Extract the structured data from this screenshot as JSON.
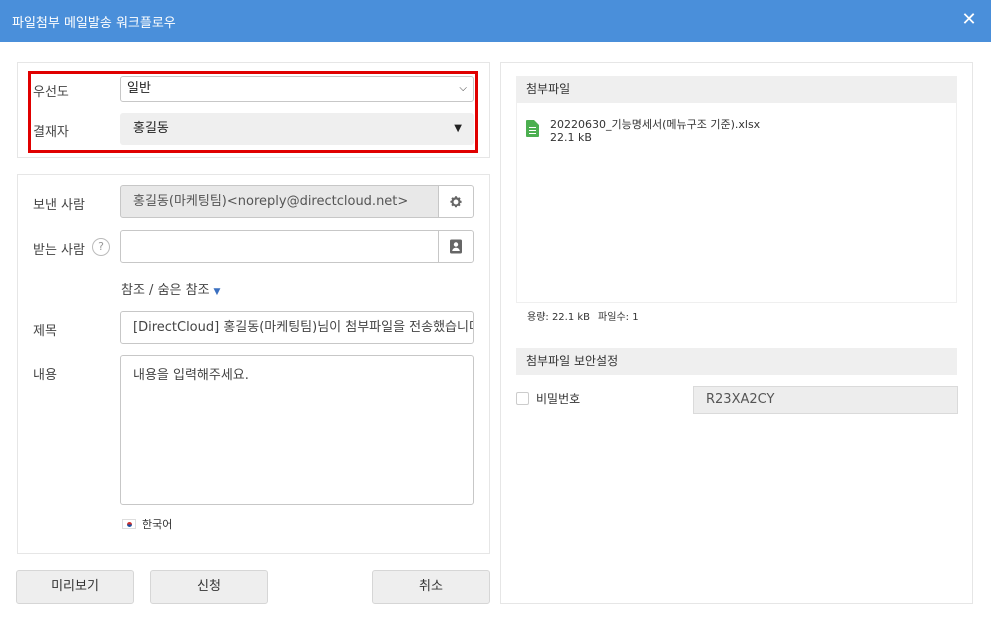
{
  "dialog": {
    "title": "파일첨부 메일발송 워크플로우",
    "close_label": "✕"
  },
  "approval": {
    "priority_label": "우선도",
    "priority_value": "일반",
    "approver_label": "결재자",
    "approver_value": "홍길동"
  },
  "mail": {
    "sender_label": "보낸 사람",
    "sender_value": "홍길동(마케팅팀)<noreply@directcloud.net>",
    "recipient_label": "받는 사람",
    "recipient_value": "",
    "help_label": "?",
    "cc_label": "참조 / 숨은 참조",
    "subject_label": "제목",
    "subject_value": "[DirectCloud] 홍길동(마케팅팀)님이 첨부파일을 전송했습니다",
    "body_label": "내용",
    "body_placeholder": "내용을 입력해주세요.",
    "language": "한국어"
  },
  "buttons": {
    "preview": "미리보기",
    "submit": "신청",
    "cancel": "취소"
  },
  "attachments": {
    "header": "첨부파일",
    "files": [
      {
        "name": "20220630_기능명세서(메뉴구조 기준).xlsx",
        "size": "22.1 kB"
      }
    ],
    "total_size": "용량: 22.1 kB",
    "file_count": "파일수: 1"
  },
  "security": {
    "header": "첨부파일 보안설정",
    "password_label": "비밀번호",
    "password_value": "R23XA2CY"
  },
  "colors": {
    "titlebar": "#4a8fda",
    "highlight": "#e00000",
    "file_icon": "#4caf50"
  }
}
